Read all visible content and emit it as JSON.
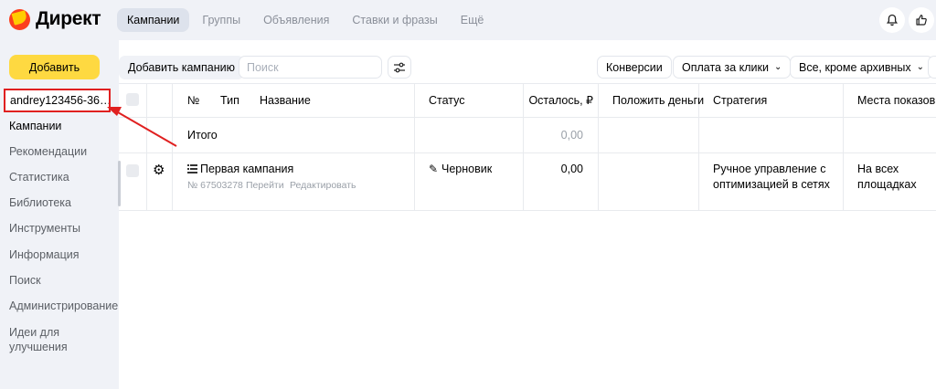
{
  "header": {
    "logo_text": "Директ",
    "tabs": [
      {
        "label": "Кампании",
        "active": true
      },
      {
        "label": "Группы",
        "active": false
      },
      {
        "label": "Объявления",
        "active": false
      },
      {
        "label": "Ставки и фразы",
        "active": false
      },
      {
        "label": "Ещё",
        "active": false
      }
    ],
    "icons": [
      "bell-icon",
      "thumbs-up-icon"
    ]
  },
  "sidebar": {
    "add_button": "Добавить",
    "account": "andrey123456-36…",
    "items": [
      {
        "label": "Кампании",
        "active": true
      },
      {
        "label": "Рекомендации"
      },
      {
        "label": "Статистика"
      },
      {
        "label": "Библиотека"
      },
      {
        "label": "Инструменты"
      },
      {
        "label": "Информация"
      },
      {
        "label": "Поиск"
      },
      {
        "label": "Администрирование"
      },
      {
        "label": "Идеи для улучшения"
      }
    ]
  },
  "toolbar": {
    "add_campaign": "Добавить кампанию",
    "search_placeholder": "Поиск",
    "conversions": "Конверсии",
    "payment": "Оплата за клики",
    "filter": "Все, кроме архивных"
  },
  "table": {
    "columns": {
      "num": "№",
      "type": "Тип",
      "name": "Название",
      "status": "Статус",
      "remaining": "Осталось, ₽",
      "deposit": "Положить деньги",
      "strategy": "Стратегия",
      "placements": "Места показов"
    },
    "total": {
      "label": "Итого",
      "remaining": "0,00"
    },
    "rows": [
      {
        "name": "Первая кампания",
        "id": "№ 67503278",
        "go": "Перейти",
        "edit": "Редактировать",
        "status": "Черновик",
        "remaining": "0,00",
        "strategy": "Ручное управление с оптимизацией в сетях",
        "placements": "На всех площадках"
      }
    ]
  },
  "colors": {
    "accent": "#fed941",
    "highlight": "#e02020",
    "sidebar_bg": "#f0f2f7"
  }
}
